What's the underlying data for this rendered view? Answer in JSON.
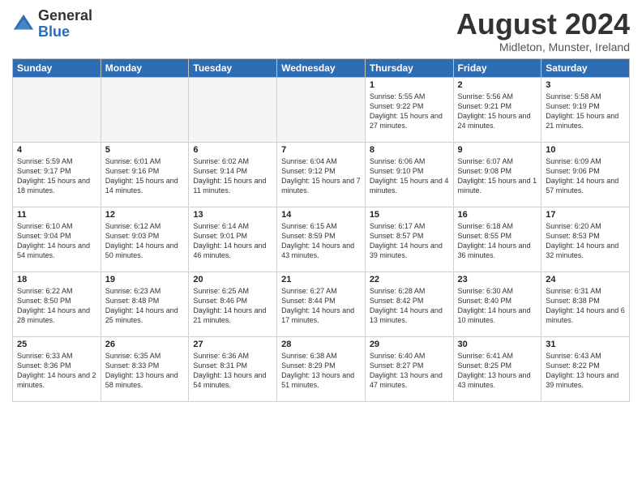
{
  "header": {
    "logo_general": "General",
    "logo_blue": "Blue",
    "month_title": "August 2024",
    "location": "Midleton, Munster, Ireland"
  },
  "days_of_week": [
    "Sunday",
    "Monday",
    "Tuesday",
    "Wednesday",
    "Thursday",
    "Friday",
    "Saturday"
  ],
  "weeks": [
    [
      {
        "day": "",
        "empty": true
      },
      {
        "day": "",
        "empty": true
      },
      {
        "day": "",
        "empty": true
      },
      {
        "day": "",
        "empty": true
      },
      {
        "day": "1",
        "sunrise": "5:55 AM",
        "sunset": "9:22 PM",
        "daylight": "15 hours and 27 minutes."
      },
      {
        "day": "2",
        "sunrise": "5:56 AM",
        "sunset": "9:21 PM",
        "daylight": "15 hours and 24 minutes."
      },
      {
        "day": "3",
        "sunrise": "5:58 AM",
        "sunset": "9:19 PM",
        "daylight": "15 hours and 21 minutes."
      }
    ],
    [
      {
        "day": "4",
        "sunrise": "5:59 AM",
        "sunset": "9:17 PM",
        "daylight": "15 hours and 18 minutes."
      },
      {
        "day": "5",
        "sunrise": "6:01 AM",
        "sunset": "9:16 PM",
        "daylight": "15 hours and 14 minutes."
      },
      {
        "day": "6",
        "sunrise": "6:02 AM",
        "sunset": "9:14 PM",
        "daylight": "15 hours and 11 minutes."
      },
      {
        "day": "7",
        "sunrise": "6:04 AM",
        "sunset": "9:12 PM",
        "daylight": "15 hours and 7 minutes."
      },
      {
        "day": "8",
        "sunrise": "6:06 AM",
        "sunset": "9:10 PM",
        "daylight": "15 hours and 4 minutes."
      },
      {
        "day": "9",
        "sunrise": "6:07 AM",
        "sunset": "9:08 PM",
        "daylight": "15 hours and 1 minute."
      },
      {
        "day": "10",
        "sunrise": "6:09 AM",
        "sunset": "9:06 PM",
        "daylight": "14 hours and 57 minutes."
      }
    ],
    [
      {
        "day": "11",
        "sunrise": "6:10 AM",
        "sunset": "9:04 PM",
        "daylight": "14 hours and 54 minutes."
      },
      {
        "day": "12",
        "sunrise": "6:12 AM",
        "sunset": "9:03 PM",
        "daylight": "14 hours and 50 minutes."
      },
      {
        "day": "13",
        "sunrise": "6:14 AM",
        "sunset": "9:01 PM",
        "daylight": "14 hours and 46 minutes."
      },
      {
        "day": "14",
        "sunrise": "6:15 AM",
        "sunset": "8:59 PM",
        "daylight": "14 hours and 43 minutes."
      },
      {
        "day": "15",
        "sunrise": "6:17 AM",
        "sunset": "8:57 PM",
        "daylight": "14 hours and 39 minutes."
      },
      {
        "day": "16",
        "sunrise": "6:18 AM",
        "sunset": "8:55 PM",
        "daylight": "14 hours and 36 minutes."
      },
      {
        "day": "17",
        "sunrise": "6:20 AM",
        "sunset": "8:53 PM",
        "daylight": "14 hours and 32 minutes."
      }
    ],
    [
      {
        "day": "18",
        "sunrise": "6:22 AM",
        "sunset": "8:50 PM",
        "daylight": "14 hours and 28 minutes."
      },
      {
        "day": "19",
        "sunrise": "6:23 AM",
        "sunset": "8:48 PM",
        "daylight": "14 hours and 25 minutes."
      },
      {
        "day": "20",
        "sunrise": "6:25 AM",
        "sunset": "8:46 PM",
        "daylight": "14 hours and 21 minutes."
      },
      {
        "day": "21",
        "sunrise": "6:27 AM",
        "sunset": "8:44 PM",
        "daylight": "14 hours and 17 minutes."
      },
      {
        "day": "22",
        "sunrise": "6:28 AM",
        "sunset": "8:42 PM",
        "daylight": "14 hours and 13 minutes."
      },
      {
        "day": "23",
        "sunrise": "6:30 AM",
        "sunset": "8:40 PM",
        "daylight": "14 hours and 10 minutes."
      },
      {
        "day": "24",
        "sunrise": "6:31 AM",
        "sunset": "8:38 PM",
        "daylight": "14 hours and 6 minutes."
      }
    ],
    [
      {
        "day": "25",
        "sunrise": "6:33 AM",
        "sunset": "8:36 PM",
        "daylight": "14 hours and 2 minutes."
      },
      {
        "day": "26",
        "sunrise": "6:35 AM",
        "sunset": "8:33 PM",
        "daylight": "13 hours and 58 minutes."
      },
      {
        "day": "27",
        "sunrise": "6:36 AM",
        "sunset": "8:31 PM",
        "daylight": "13 hours and 54 minutes."
      },
      {
        "day": "28",
        "sunrise": "6:38 AM",
        "sunset": "8:29 PM",
        "daylight": "13 hours and 51 minutes."
      },
      {
        "day": "29",
        "sunrise": "6:40 AM",
        "sunset": "8:27 PM",
        "daylight": "13 hours and 47 minutes."
      },
      {
        "day": "30",
        "sunrise": "6:41 AM",
        "sunset": "8:25 PM",
        "daylight": "13 hours and 43 minutes."
      },
      {
        "day": "31",
        "sunrise": "6:43 AM",
        "sunset": "8:22 PM",
        "daylight": "13 hours and 39 minutes."
      }
    ]
  ],
  "labels": {
    "sunrise_label": "Sunrise:",
    "sunset_label": "Sunset:",
    "daylight_label": "Daylight:"
  }
}
